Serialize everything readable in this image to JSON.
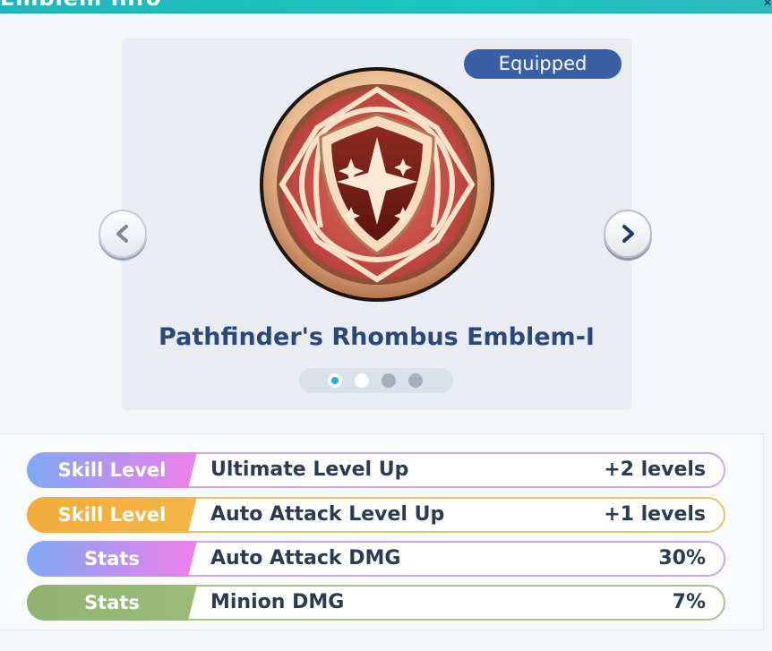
{
  "header": {
    "title": "Emblem Info"
  },
  "emblem": {
    "badge": "Equipped",
    "name": "Pathfinder's Rhombus Emblem-I",
    "pages": 4,
    "current_page": 2
  },
  "attributes": [
    {
      "tag": "Skill Level",
      "tag_colors": [
        "#7fa9f5",
        "#ee7fe9"
      ],
      "border": "#c9a8f0",
      "name": "Ultimate Level Up",
      "value": "+2 levels"
    },
    {
      "tag": "Skill Level",
      "tag_colors": [
        "#f0ad3c",
        "#f5b548"
      ],
      "border": "#eec06a",
      "name": "Auto Attack Level Up",
      "value": "+1 levels"
    },
    {
      "tag": "Stats",
      "tag_colors": [
        "#7fa9f5",
        "#ee7fe9"
      ],
      "border": "#c9a8f0",
      "name": "Auto Attack DMG",
      "value": "30%"
    },
    {
      "tag": "Stats",
      "tag_colors": [
        "#8fb36f",
        "#9bbd78"
      ],
      "border": "#a7c48d",
      "name": "Minion DMG",
      "value": "7%"
    }
  ]
}
